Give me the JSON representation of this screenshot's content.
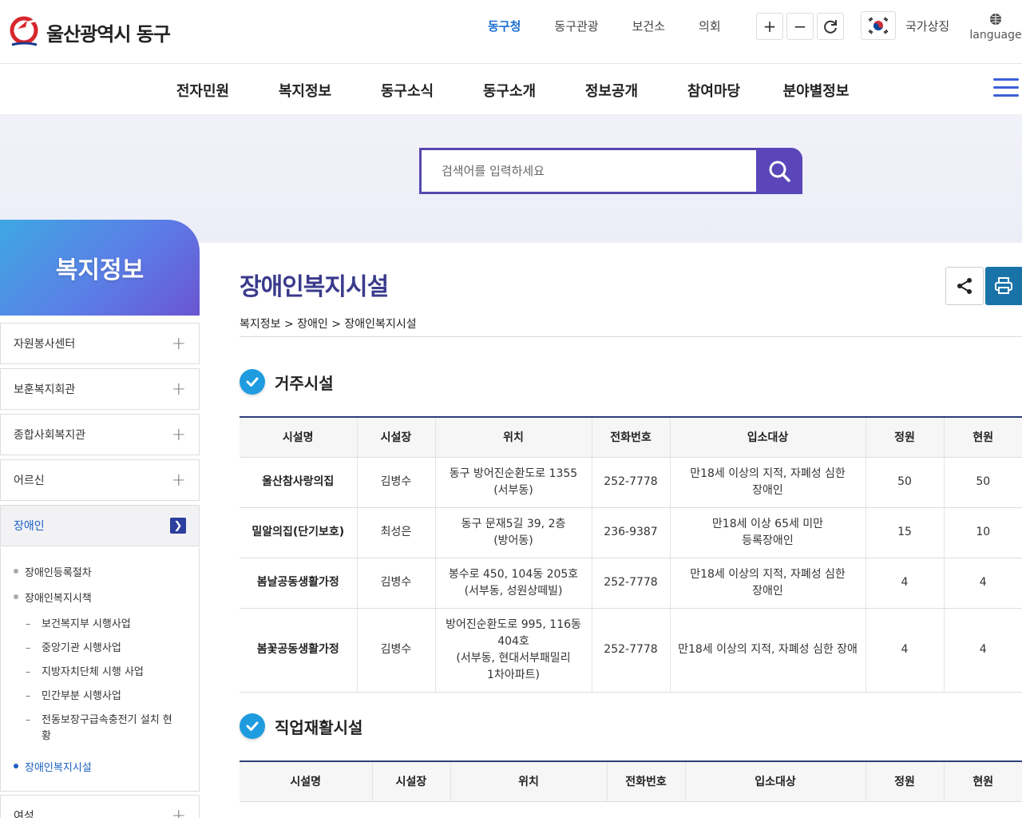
{
  "header": {
    "site_title": "울산광역시 동구",
    "top_nav": [
      {
        "label": "동구청",
        "active": true
      },
      {
        "label": "동구관광",
        "active": false
      },
      {
        "label": "보건소",
        "active": false
      },
      {
        "label": "의회",
        "active": false
      }
    ],
    "zoom_in_glyph": "+",
    "zoom_out_glyph": "−",
    "national_symbol_label": "국가상징",
    "language_label": "language",
    "accent_color": "#1a6fd1"
  },
  "main_menu": [
    "전자민원",
    "복지정보",
    "동구소식",
    "동구소개",
    "정보공개",
    "참여마당",
    "분야별정보"
  ],
  "search": {
    "placeholder": "검색어를 입력하세요",
    "button_color": "#5a46b8"
  },
  "sidebar": {
    "title": "복지정보",
    "items": [
      {
        "label": "자원봉사센터"
      },
      {
        "label": "보훈복지회관"
      },
      {
        "label": "종합사회복지관"
      },
      {
        "label": "어르신"
      },
      {
        "label": "장애인"
      },
      {
        "label": "여성"
      }
    ],
    "sub_items": [
      {
        "label": "장애인등록절차"
      },
      {
        "label": "장애인복지시책"
      },
      {
        "label": "장애인복지시설"
      }
    ],
    "sub_sub_items": [
      {
        "label": "보건복지부 시행사업"
      },
      {
        "label": "중앙기관 시행사업"
      },
      {
        "label": "지방자치단체 시행 사업"
      },
      {
        "label": "민간부분 시행사업"
      },
      {
        "label": "전동보장구급속충전기 설치 현황"
      }
    ]
  },
  "content": {
    "page_title": "장애인복지시설",
    "breadcrumb": "복지정보 > 장애인 > 장애인복지시설",
    "sections": [
      {
        "title": "거주시설",
        "headers": [
          "시설명",
          "시설장",
          "위치",
          "전화번호",
          "입소대상",
          "정원",
          "현원"
        ],
        "rows": [
          [
            "울산참사랑의집",
            "김병수",
            "동구 방어진순환도로 1355\n(서부동)",
            "252-7778",
            "만18세 이상의 지적, 자폐성 심한\n장애인",
            "50",
            "50"
          ],
          [
            "밀알의집(단기보호)",
            "최성은",
            "동구 문재5길 39, 2층\n(방어동)",
            "236-9387",
            "만18세 이상 65세 미만\n등록장애인",
            "15",
            "10"
          ],
          [
            "봄날공동생활가정",
            "김병수",
            "봉수로 450, 104동 205호\n(서부동, 성원상떼빌)",
            "252-7778",
            "만18세 이상의 지적, 자폐성 심한\n장애인",
            "4",
            "4"
          ],
          [
            "봄꽃공동생활가정",
            "김병수",
            "방어진순환도로 995, 116동\n404호\n(서부동, 현대서부패밀리\n1차아파트)",
            "252-7778",
            "만18세 이상의 지적, 자폐성 심한 장애",
            "4",
            "4"
          ]
        ]
      },
      {
        "title": "직업재활시설",
        "headers": [
          "시설명",
          "시설장",
          "위치",
          "전화번호",
          "입소대상",
          "정원",
          "현원"
        ],
        "rows": []
      }
    ]
  }
}
